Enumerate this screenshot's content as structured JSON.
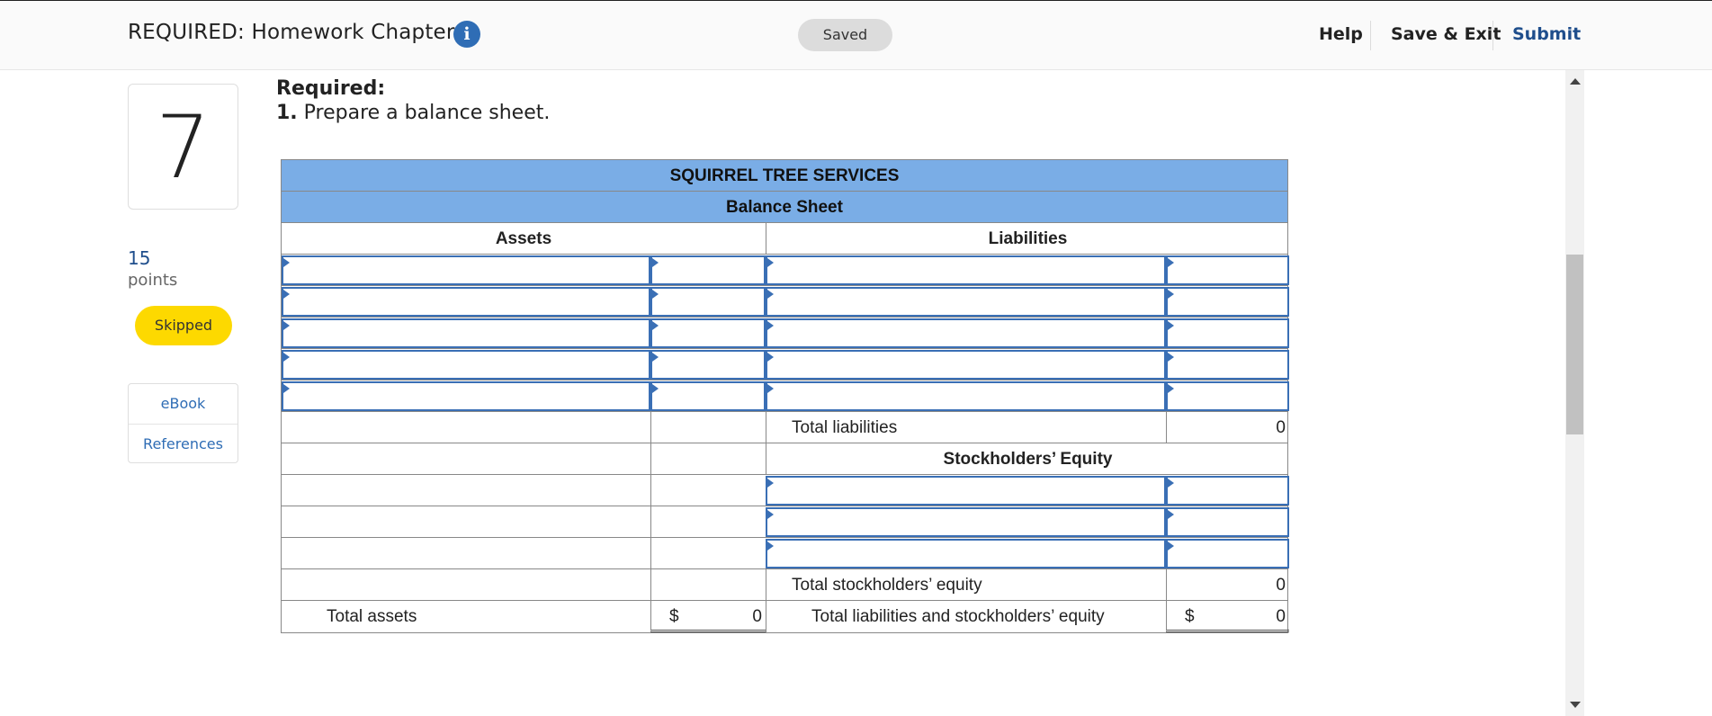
{
  "header": {
    "title": "REQUIRED: Homework Chapter 2",
    "info_glyph": "i",
    "status": "Saved",
    "links": {
      "help": "Help",
      "save_exit": "Save & Exit",
      "submit": "Submit"
    }
  },
  "sidebar": {
    "question_number": "7",
    "points_value": "15",
    "points_label": "points",
    "status_badge": "Skipped",
    "resources": [
      "eBook",
      "References"
    ]
  },
  "question": {
    "required_label": "Required:",
    "part_number": "1.",
    "instruction": "Prepare a balance sheet."
  },
  "balance_sheet": {
    "company": "SQUIRREL TREE SERVICES",
    "statement": "Balance Sheet",
    "assets_header": "Assets",
    "liabilities_header": "Liabilities",
    "total_liabilities_label": "Total liabilities",
    "total_liabilities_value": "0",
    "equity_header": "Stockholders’ Equity",
    "total_equity_label": "Total stockholders’ equity",
    "total_equity_value": "0",
    "total_assets_label": "Total assets",
    "total_assets_currency": "$",
    "total_assets_value": "0",
    "total_liab_equity_label": "Total liabilities and stockholders’ equity",
    "total_liab_equity_currency": "$",
    "total_liab_equity_value": "0"
  },
  "icons": {
    "info": "info-icon",
    "scroll_up": "scroll-up-arrow-icon",
    "scroll_down": "scroll-down-arrow-icon"
  },
  "colors": {
    "accent_blue": "#2f6db5",
    "table_band": "#7aade6",
    "skipped_badge": "#fdd900",
    "input_border": "#3a6fb5"
  }
}
